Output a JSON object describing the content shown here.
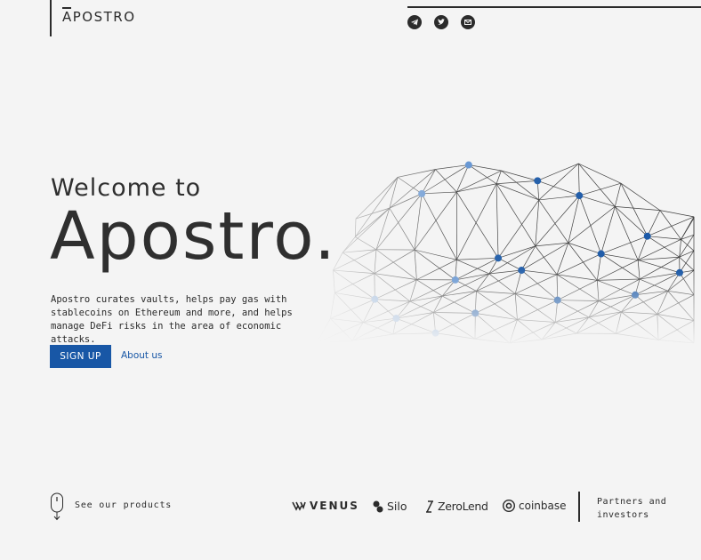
{
  "header": {
    "logo_text": "APOSTRO",
    "social": [
      {
        "icon": "telegram-icon"
      },
      {
        "icon": "twitter-icon"
      },
      {
        "icon": "email-icon"
      }
    ]
  },
  "hero": {
    "welcome": "Welcome to",
    "title": "Apostro.",
    "description": "Apostro curates vaults, helps pay gas with stablecoins on Ethereum and more, and helps manage DeFi risks in the area of economic attacks.",
    "signup_label": "SIGN UP",
    "about_label": "About us"
  },
  "footer": {
    "products_label": "See our products",
    "partners": [
      {
        "name": "VENUS",
        "icon": "venus-logo-icon"
      },
      {
        "name": "Silo",
        "icon": "silo-logo-icon"
      },
      {
        "name": "ZeroLend",
        "icon": "zerolend-logo-icon"
      },
      {
        "name": "coinbase",
        "icon": "coinbase-logo-icon"
      }
    ],
    "partners_label": "Partners and investors"
  },
  "colors": {
    "accent": "#1857a6",
    "text": "#2b2b2b",
    "background": "#f4f4f4"
  }
}
